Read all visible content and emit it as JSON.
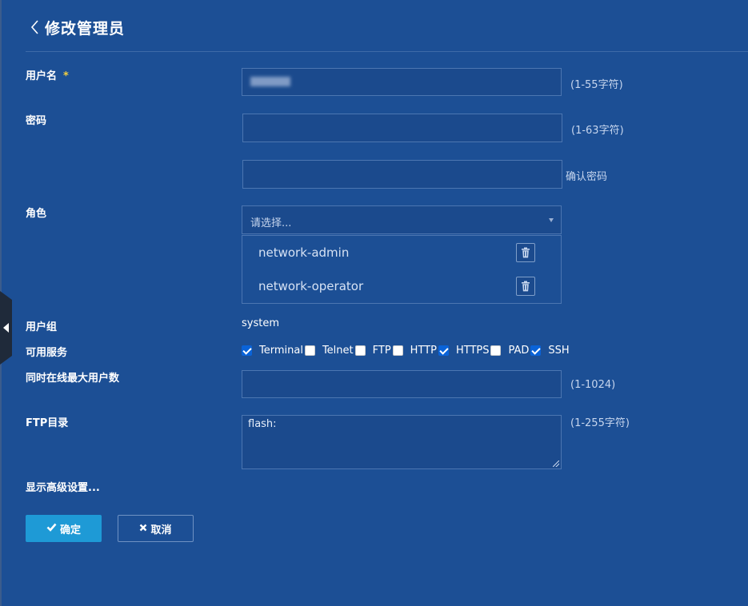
{
  "header": {
    "title": "修改管理员"
  },
  "form": {
    "username": {
      "label": "用户名",
      "required_mark": "*",
      "value": "",
      "hint": "(1-55字符)"
    },
    "password": {
      "label": "密码",
      "value": "",
      "hint": "(1-63字符)"
    },
    "confirm_password": {
      "value": "",
      "label": "确认密码"
    },
    "role": {
      "label": "角色",
      "placeholder": "请选择...",
      "selected_roles": [
        "network-admin",
        "network-operator"
      ]
    },
    "user_group": {
      "label": "用户组",
      "value": "system"
    },
    "services": {
      "label": "可用服务",
      "items": [
        {
          "name": "Terminal",
          "checked": true
        },
        {
          "name": "Telnet",
          "checked": false
        },
        {
          "name": "FTP",
          "checked": false
        },
        {
          "name": "HTTP",
          "checked": false
        },
        {
          "name": "HTTPS",
          "checked": true
        },
        {
          "name": "PAD",
          "checked": false
        },
        {
          "name": "SSH",
          "checked": true
        }
      ]
    },
    "max_online_users": {
      "label": "同时在线最大用户数",
      "value": "",
      "hint": "(1-1024)"
    },
    "ftp_dir": {
      "label": "FTP目录",
      "value": "flash:",
      "hint": "(1-255字符)"
    },
    "advanced_link": "显示高级设置..."
  },
  "buttons": {
    "ok": "确定",
    "cancel": "取消"
  },
  "icons": {
    "back": "chevron-left-icon",
    "trash": "trash-icon",
    "ok": "check-icon",
    "cancel": "close-icon",
    "collapse": "caret-left-icon"
  },
  "colors": {
    "background": "#1c4f95",
    "primary_button": "#1e9ad6",
    "checkbox_checked": "#0a63d8",
    "required": "#f4d03f"
  }
}
